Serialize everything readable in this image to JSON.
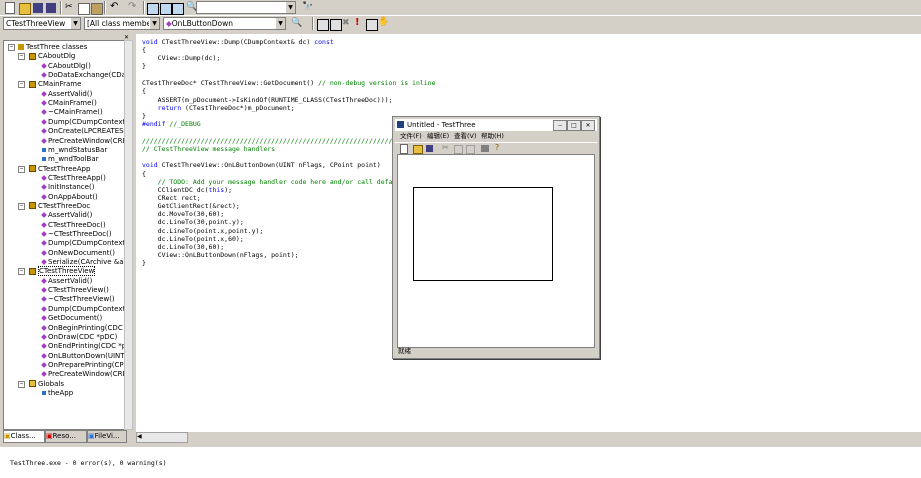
{
  "toolbar": {
    "find_combo_value": "",
    "class_combo": "CTestThreeView",
    "filter_combo": "[All class members]",
    "member_combo": "OnLButtonDown"
  },
  "tree": {
    "root": "TestThree classes",
    "nodes": [
      {
        "label": "CAboutDlg",
        "kind": "class"
      },
      {
        "label": "CAboutDlg()",
        "kind": "fn"
      },
      {
        "label": "DoDataExchange(CDat",
        "kind": "fn"
      },
      {
        "label": "CMainFrame",
        "kind": "class"
      },
      {
        "label": "AssertValid()",
        "kind": "fn"
      },
      {
        "label": "CMainFrame()",
        "kind": "fn"
      },
      {
        "label": "~CMainFrame()",
        "kind": "fn"
      },
      {
        "label": "Dump(CDumpContext &",
        "kind": "fn"
      },
      {
        "label": "OnCreate(LPCREATES",
        "kind": "fn"
      },
      {
        "label": "PreCreateWindow(CRE",
        "kind": "fn"
      },
      {
        "label": "m_wndStatusBar",
        "kind": "var"
      },
      {
        "label": "m_wndToolBar",
        "kind": "var"
      },
      {
        "label": "CTestThreeApp",
        "kind": "class"
      },
      {
        "label": "CTestThreeApp()",
        "kind": "fn"
      },
      {
        "label": "InitInstance()",
        "kind": "fn"
      },
      {
        "label": "OnAppAbout()",
        "kind": "fn"
      },
      {
        "label": "CTestThreeDoc",
        "kind": "class"
      },
      {
        "label": "AssertValid()",
        "kind": "fn"
      },
      {
        "label": "CTestThreeDoc()",
        "kind": "fn"
      },
      {
        "label": "~CTestThreeDoc()",
        "kind": "fn"
      },
      {
        "label": "Dump(CDumpContext &",
        "kind": "fn"
      },
      {
        "label": "OnNewDocument()",
        "kind": "fn"
      },
      {
        "label": "Serialize(CArchive &ar",
        "kind": "fn"
      },
      {
        "label": "CTestThreeView",
        "kind": "class"
      },
      {
        "label": "AssertValid()",
        "kind": "fn"
      },
      {
        "label": "CTestThreeView()",
        "kind": "fn"
      },
      {
        "label": "~CTestThreeView()",
        "kind": "fn"
      },
      {
        "label": "Dump(CDumpContext &",
        "kind": "fn"
      },
      {
        "label": "GetDocument()",
        "kind": "fn"
      },
      {
        "label": "OnBeginPrinting(CDC *",
        "kind": "fn"
      },
      {
        "label": "OnDraw(CDC *pDC)",
        "kind": "fn"
      },
      {
        "label": "OnEndPrinting(CDC *pl",
        "kind": "fn"
      },
      {
        "label": "OnLButtonDown(UINT",
        "kind": "fn"
      },
      {
        "label": "OnPreparePrinting(CPr",
        "kind": "fn"
      },
      {
        "label": "PreCreateWindow(CRE",
        "kind": "fn"
      },
      {
        "label": "Globals",
        "kind": "folder"
      },
      {
        "label": "theApp",
        "kind": "var"
      }
    ]
  },
  "bottom_tabs": [
    "Class...",
    "Reso...",
    "FileVi..."
  ],
  "code_lines": [
    [
      {
        "t": "void ",
        "c": "kw"
      },
      {
        "t": "CTestThreeView::Dump(CDumpContext& dc) ",
        "c": ""
      },
      {
        "t": "const",
        "c": "kw"
      }
    ],
    [
      {
        "t": "{",
        "c": ""
      }
    ],
    [
      {
        "t": "    CView::Dump(dc);",
        "c": ""
      }
    ],
    [
      {
        "t": "}",
        "c": ""
      }
    ],
    [
      {
        "t": "",
        "c": ""
      }
    ],
    [
      {
        "t": "CTestThreeDoc* CTestThreeView::GetDocument() ",
        "c": ""
      },
      {
        "t": "// non-debug version is inline",
        "c": "cm"
      }
    ],
    [
      {
        "t": "{",
        "c": ""
      }
    ],
    [
      {
        "t": "    ASSERT(m_pDocument->IsKindOf(RUNTIME_CLASS(CTestThreeDoc)));",
        "c": ""
      }
    ],
    [
      {
        "t": "    ",
        "c": ""
      },
      {
        "t": "return",
        "c": "kw"
      },
      {
        "t": " (CTestThreeDoc*)m_pDocument;",
        "c": ""
      }
    ],
    [
      {
        "t": "}",
        "c": ""
      }
    ],
    [
      {
        "t": "#endif ",
        "c": "kw"
      },
      {
        "t": "//_DEBUG",
        "c": "cm"
      }
    ],
    [
      {
        "t": "",
        "c": ""
      }
    ],
    [
      {
        "t": "////////////////////////////////////////////////////////////////////////////",
        "c": "cm"
      }
    ],
    [
      {
        "t": "// CTestThreeView message handlers",
        "c": "cm"
      }
    ],
    [
      {
        "t": "",
        "c": ""
      }
    ],
    [
      {
        "t": "void ",
        "c": "kw"
      },
      {
        "t": "CTestThreeView::OnLButtonDown(UINT nFlags, CPoint point)",
        "c": ""
      }
    ],
    [
      {
        "t": "{",
        "c": ""
      }
    ],
    [
      {
        "t": "    ",
        "c": ""
      },
      {
        "t": "// TODO: Add your message handler code here and/or call default",
        "c": "cm"
      }
    ],
    [
      {
        "t": "    CClientDC dc(",
        "c": ""
      },
      {
        "t": "this",
        "c": "kw"
      },
      {
        "t": ");",
        "c": ""
      }
    ],
    [
      {
        "t": "    CRect rect;",
        "c": ""
      }
    ],
    [
      {
        "t": "    GetClientRect(&rect);",
        "c": ""
      }
    ],
    [
      {
        "t": "    dc.MoveTo(30,60);",
        "c": ""
      }
    ],
    [
      {
        "t": "    dc.LineTo(30,point.y);",
        "c": ""
      }
    ],
    [
      {
        "t": "    dc.LineTo(point.x,point.y);",
        "c": ""
      }
    ],
    [
      {
        "t": "    dc.LineTo(point.x,60);",
        "c": ""
      }
    ],
    [
      {
        "t": "    dc.LineTo(30,60);",
        "c": ""
      }
    ],
    [
      {
        "t": "    CView::OnLButtonDown(nFlags, point);",
        "c": ""
      }
    ],
    [
      {
        "t": "}",
        "c": ""
      }
    ]
  ],
  "child_window": {
    "title": "Untitled - TestThree",
    "menu": [
      "文件(F)",
      "编辑(E)",
      "查看(V)",
      "帮助(H)"
    ],
    "status": "就绪"
  },
  "output": {
    "text": "TestThree.exe - 0 error(s), 0 warning(s)"
  },
  "colors": {
    "keyword": "#0000ff",
    "comment": "#008000",
    "face": "#d4d0c8"
  }
}
